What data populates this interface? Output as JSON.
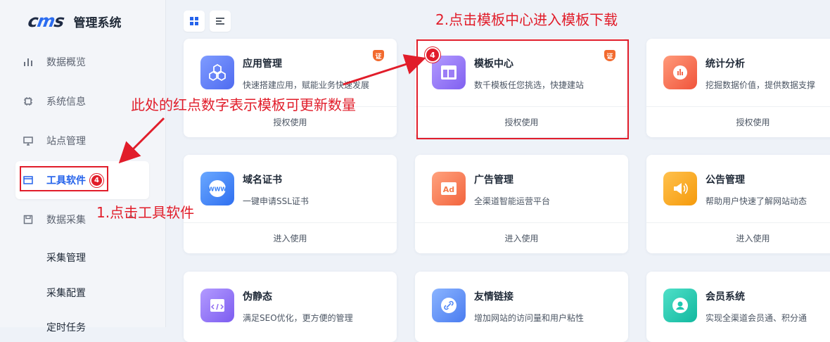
{
  "app": {
    "logo": "cms",
    "title": "管理系统"
  },
  "sidebar": {
    "items": [
      {
        "label": "数据概览",
        "icon": "bar-chart-icon"
      },
      {
        "label": "系统信息",
        "icon": "chip-icon"
      },
      {
        "label": "站点管理",
        "icon": "monitor-icon"
      },
      {
        "label": "工具软件",
        "icon": "window-icon",
        "badge": "4",
        "active": true
      },
      {
        "label": "数据采集",
        "icon": "save-icon",
        "expanded": true
      }
    ],
    "sub_items": [
      "采集管理",
      "采集配置",
      "定时任务"
    ]
  },
  "toolbar": {
    "grid_view": "grid-view-icon",
    "list_view": "list-view-icon"
  },
  "cards": [
    {
      "title": "应用管理",
      "desc": "快速搭建应用，赋能业务快速发展",
      "action": "授权使用",
      "cert": "证",
      "icon": "cubes-icon",
      "color": "#5b7cf6"
    },
    {
      "title": "模板中心",
      "desc": "数千模板任您挑选，快捷建站",
      "action": "授权使用",
      "cert": "证",
      "badge": "4",
      "icon": "layout-icon",
      "color": "#8b6cf5"
    },
    {
      "title": "统计分析",
      "desc": "挖掘数据价值，提供数据支撑",
      "action": "授权使用",
      "icon": "stats-icon",
      "color": "#f36b4f"
    },
    {
      "title": "域名证书",
      "desc": "一键申请SSL证书",
      "action": "进入使用",
      "icon": "www-icon",
      "color": "#3b82f6"
    },
    {
      "title": "广告管理",
      "desc": "全渠道智能运营平台",
      "action": "进入使用",
      "icon": "ad-icon",
      "color": "#f47a4a"
    },
    {
      "title": "公告管理",
      "desc": "帮助用户快速了解网站动态",
      "action": "进入使用",
      "icon": "speaker-icon",
      "color": "#f6a01e"
    },
    {
      "title": "伪静态",
      "desc": "满足SEO优化，更方便的管理",
      "action": "进入使用",
      "icon": "code-icon",
      "color": "#8f6cf2"
    },
    {
      "title": "友情链接",
      "desc": "增加网站的访问量和用户粘性",
      "action": "进入使用",
      "icon": "link-icon",
      "color": "#4f86f7"
    },
    {
      "title": "会员系统",
      "desc": "实现全渠道会员通、积分通",
      "action": "进入使用",
      "icon": "user-icon",
      "color": "#1ec8b0"
    }
  ],
  "annotations": {
    "step1": "1.点击工具软件",
    "step2": "2.点击模板中心进入模板下载",
    "badge_note": "此处的红点数字表示模板可更新数量"
  }
}
